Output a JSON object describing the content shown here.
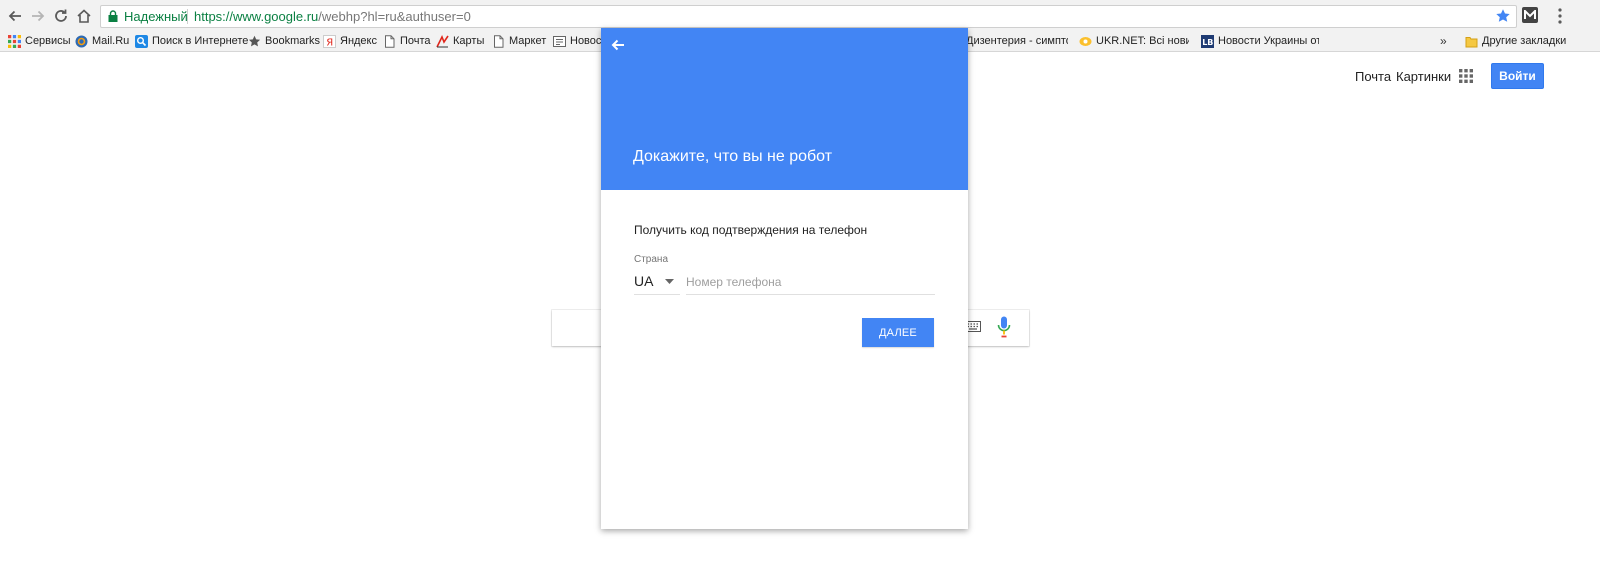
{
  "browser": {
    "security_label": "Надежный",
    "url_host": "https://www.google.ru",
    "url_path": "/webhp?hl=ru&authuser=0",
    "accent": "#4285f4"
  },
  "bookmarks": {
    "items": [
      {
        "label": "Сервисы",
        "icon": "apps-grid-icon"
      },
      {
        "label": "Mail.Ru",
        "icon": "mailru-icon"
      },
      {
        "label": "Поиск в Интернете",
        "icon": "search-icon"
      },
      {
        "label": "Bookmarks",
        "icon": "star-icon"
      },
      {
        "label": "Яндекс",
        "icon": "yandex-icon"
      },
      {
        "label": "Почта",
        "icon": "page-icon"
      },
      {
        "label": "Карты",
        "icon": "maps-icon"
      },
      {
        "label": "Маркет",
        "icon": "page-icon"
      },
      {
        "label": "Новост",
        "icon": "news-icon"
      },
      {
        "label": "Дизентерия - симпто",
        "icon": "site-icon"
      },
      {
        "label": "UKR.NET: Всі новини",
        "icon": "ukrnet-icon"
      },
      {
        "label": "Новости Украины от",
        "icon": "lb-icon"
      }
    ],
    "overflow": "»",
    "other_folder": "Другие закладки"
  },
  "google": {
    "mail_link": "Почта",
    "images_link": "Картинки",
    "signin": "Войти"
  },
  "dialog": {
    "title": "Докажите, что вы не робот",
    "subtitle": "Получить код подтверждения на телефон",
    "country_label": "Страна",
    "country_value": "UA",
    "phone_placeholder": "Номер телефона",
    "next_button": "ДАЛЕЕ"
  }
}
